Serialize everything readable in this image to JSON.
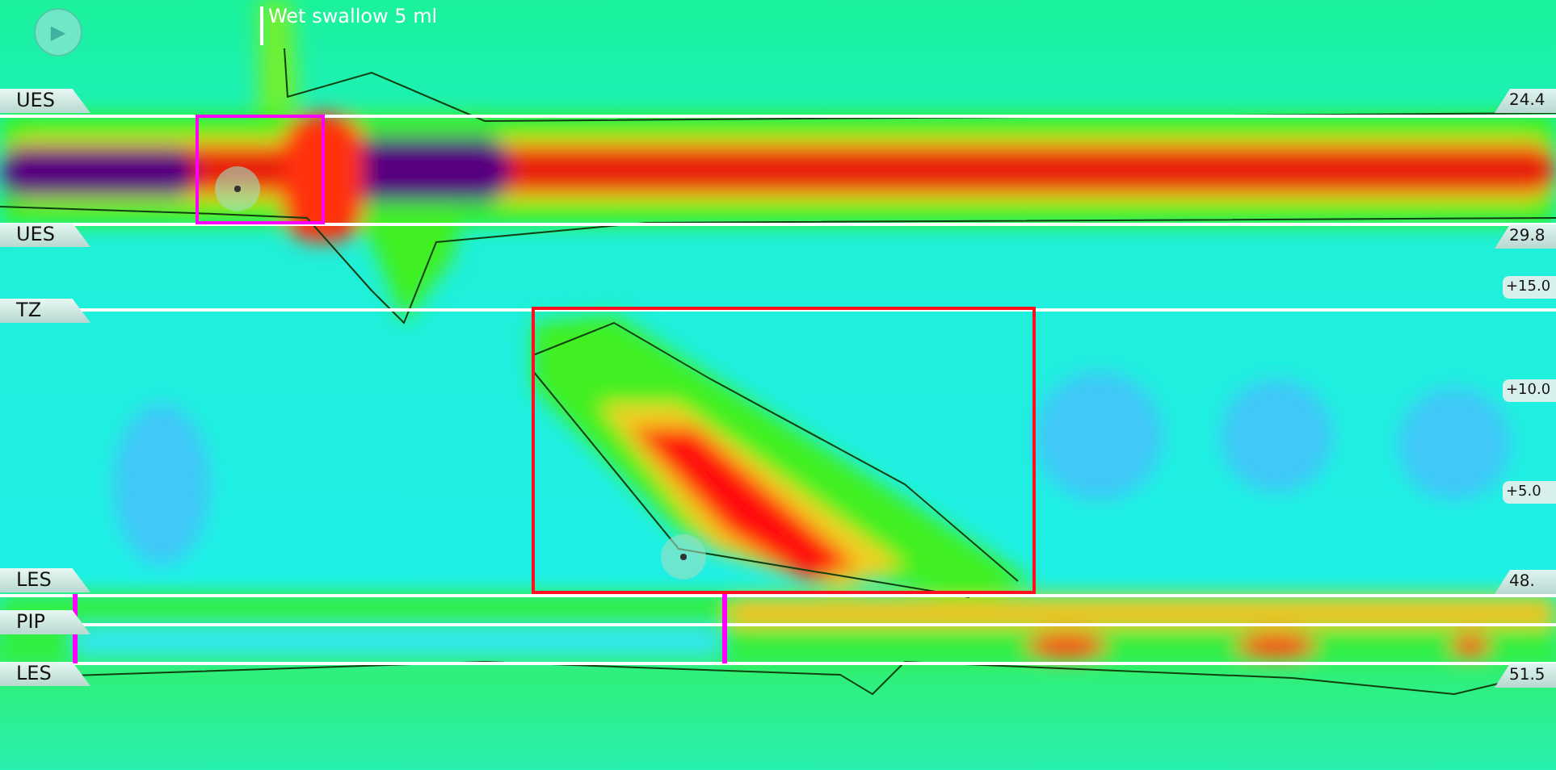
{
  "play_button": {
    "icon": "▶"
  },
  "swallow_marker": {
    "label": "Wet swallow 5 ml"
  },
  "left_markers": [
    {
      "label": "UES"
    },
    {
      "label": "UES"
    },
    {
      "label": "TZ"
    },
    {
      "label": "LES"
    },
    {
      "label": "PIP"
    },
    {
      "label": "LES"
    }
  ],
  "right_markers": [
    {
      "label": "24.4",
      "kind": "depth"
    },
    {
      "label": "29.8",
      "kind": "depth"
    },
    {
      "label": "+15.0",
      "kind": "scale"
    },
    {
      "label": "+10.0",
      "kind": "scale"
    },
    {
      "label": "+5.0",
      "kind": "scale"
    },
    {
      "label": "48.",
      "kind": "depth"
    },
    {
      "label": "51.5",
      "kind": "depth"
    }
  ]
}
